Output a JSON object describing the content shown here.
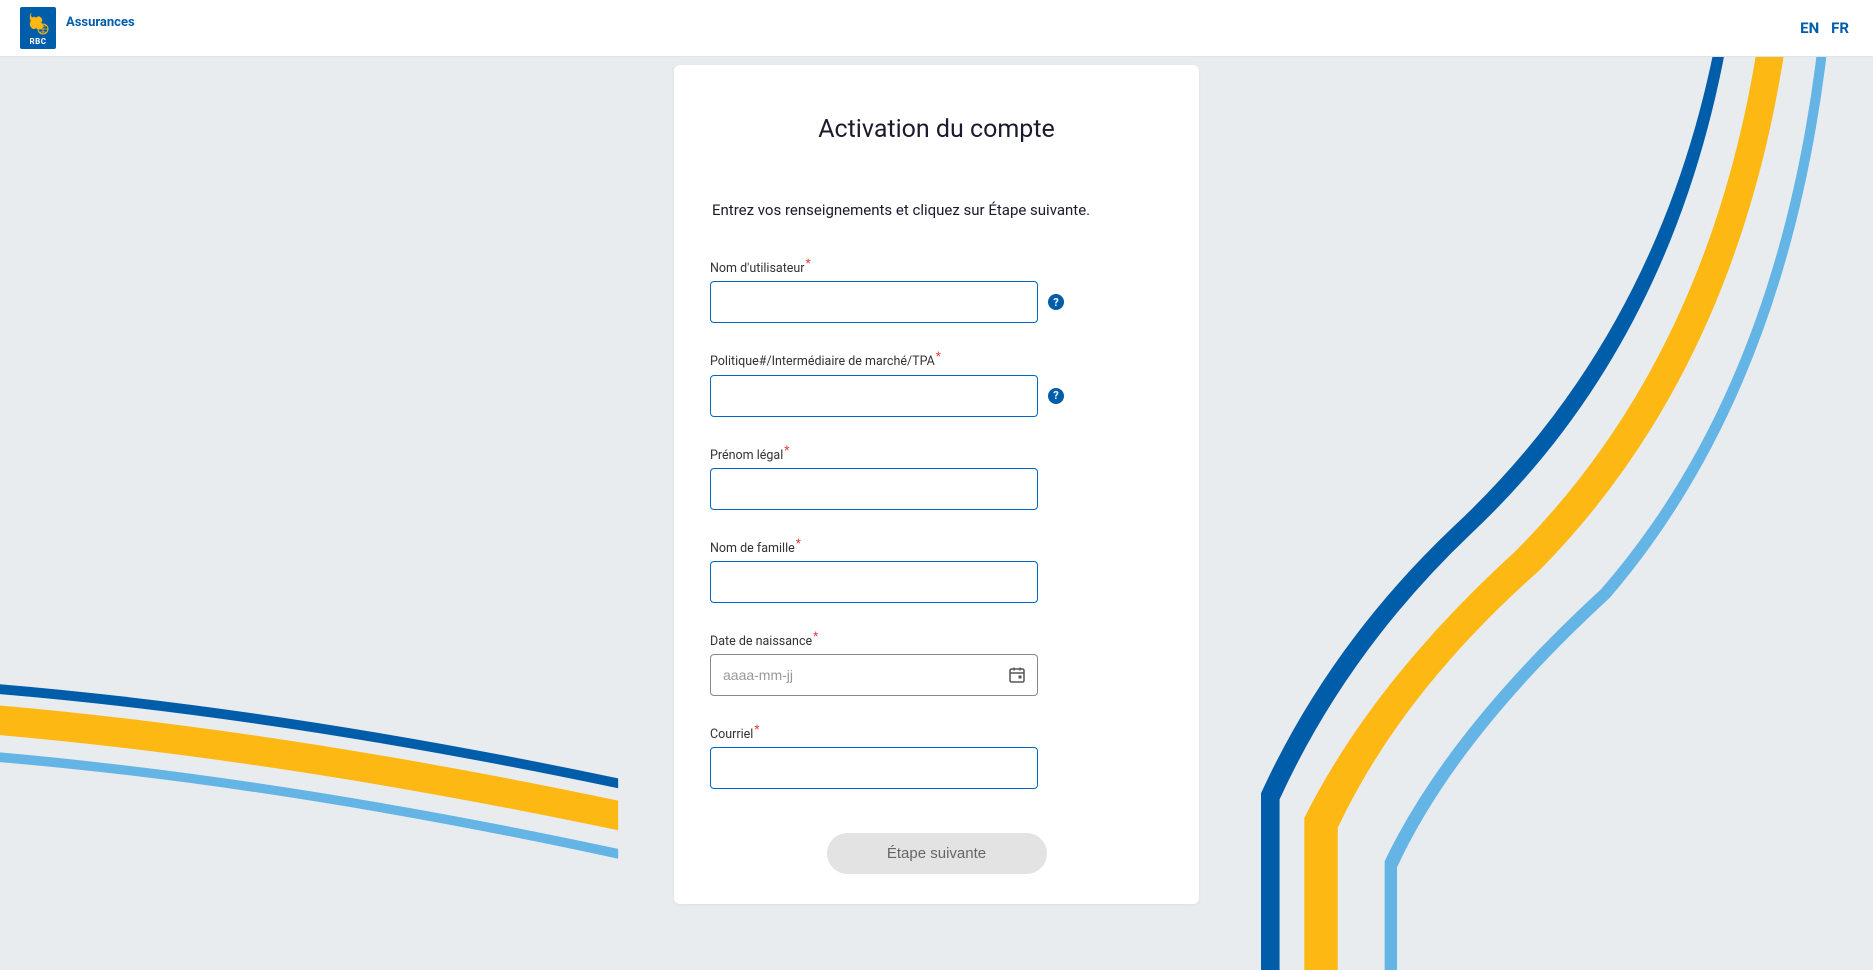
{
  "header": {
    "brand": "Assurances",
    "logo_abbr": "RBC",
    "lang": {
      "en": "EN",
      "fr": "FR"
    }
  },
  "card": {
    "title": "Activation du compte",
    "subtitle": "Entrez vos renseignements et cliquez sur Étape suivante."
  },
  "form": {
    "username": {
      "label": "Nom d'utilisateur",
      "value": ""
    },
    "policy": {
      "label": "Politique#/Intermédiaire de marché/TPA",
      "value": ""
    },
    "firstname": {
      "label": "Prénom légal",
      "value": ""
    },
    "lastname": {
      "label": "Nom de famille",
      "value": ""
    },
    "dob": {
      "label": "Date de naissance",
      "placeholder": "aaaa-mm-jj",
      "value": ""
    },
    "email": {
      "label": "Courriel",
      "value": ""
    },
    "submit_label": "Étape suivante"
  },
  "icons": {
    "help": "?"
  }
}
